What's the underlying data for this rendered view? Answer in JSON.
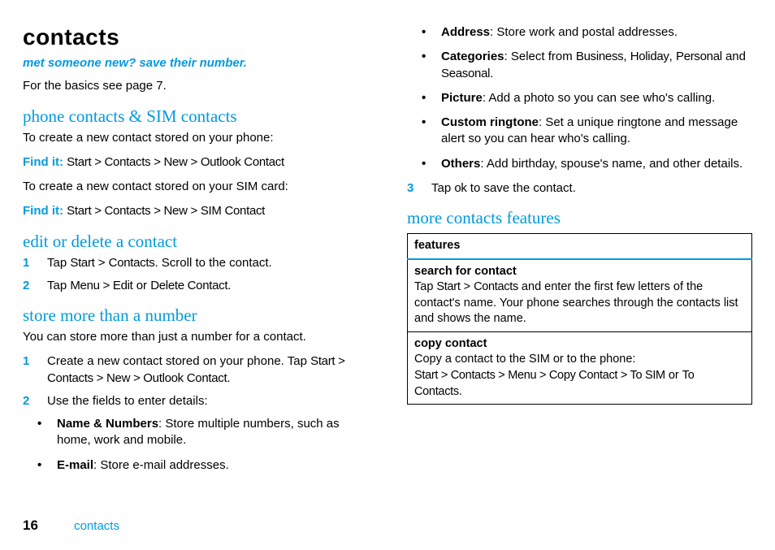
{
  "left": {
    "title": "contacts",
    "tagline": "met someone new? save their number.",
    "basics": "For the basics see page 7.",
    "sec1": {
      "heading": "phone contacts & SIM contacts",
      "p1": "To create a new contact stored on your phone:",
      "find1_label": "Find it:",
      "find1_path": "Start > Contacts > New > Outlook Contact",
      "p2": "To create a new contact stored on your SIM card:",
      "find2_label": "Find it:",
      "find2_path": "Start > Contacts > New > SIM Contact"
    },
    "sec2": {
      "heading": "edit or delete a contact",
      "step1_pre": "Tap ",
      "step1_b1": "Start",
      "step1_mid": " > ",
      "step1_b2": "Contacts",
      "step1_post": ". Scroll to the contact.",
      "step2_pre": "Tap ",
      "step2_b1": "Menu > Edit",
      "step2_mid": " or ",
      "step2_b2": "Delete Contact",
      "step2_post": "."
    },
    "sec3": {
      "heading": "store more than a number",
      "intro": "You can store more than just a number for a contact.",
      "step1_pre": "Create a new contact stored on your phone. Tap ",
      "step1_path": "Start > Contacts > New > Outlook Contact",
      "step1_post": ".",
      "step2": "Use the fields to enter details:",
      "bul1_b": "Name & Numbers",
      "bul1_t": ": Store multiple numbers, such as home, work and mobile.",
      "bul2_b": "E-mail",
      "bul2_t": ": Store e-mail addresses."
    }
  },
  "right": {
    "bul1_b": "Address",
    "bul1_t": ": Store work and postal addresses.",
    "bul2_b": "Categories",
    "bul2_pre": ": Select from ",
    "bul2_c1": "Business",
    "bul2_s1": ", ",
    "bul2_c2": "Holiday",
    "bul2_s2": ", ",
    "bul2_c3": "Personal",
    "bul2_s3": " and ",
    "bul2_c4": "Seasonal",
    "bul2_post": ".",
    "bul3_b": "Picture",
    "bul3_t": ": Add a photo so you can see who's calling.",
    "bul4_b": "Custom ringtone",
    "bul4_t": ": Set a unique ringtone and message alert so you can hear who's calling.",
    "bul5_b": "Others",
    "bul5_t": ": Add birthday, spouse's name, and other details.",
    "step3_pre": "Tap ",
    "step3_b": "ok",
    "step3_post": " to save the contact.",
    "sec4": {
      "heading": "more contacts features",
      "th": "features",
      "r1_title": "search for contact",
      "r1_pre": "Tap ",
      "r1_b1": "Start",
      "r1_mid": " > ",
      "r1_b2": "Contacts",
      "r1_post": " and enter the first few letters of the contact's name. Your phone searches through the contacts list and shows the name.",
      "r2_title": "copy contact",
      "r2_intro": "Copy a contact to the SIM or to the phone:",
      "r2_path_a": "Start > Contacts > Menu > Copy Contact > To SIM",
      "r2_or": " or ",
      "r2_path_b": "To Contacts",
      "r2_post": "."
    }
  },
  "footer": {
    "page": "16",
    "section": "contacts"
  }
}
